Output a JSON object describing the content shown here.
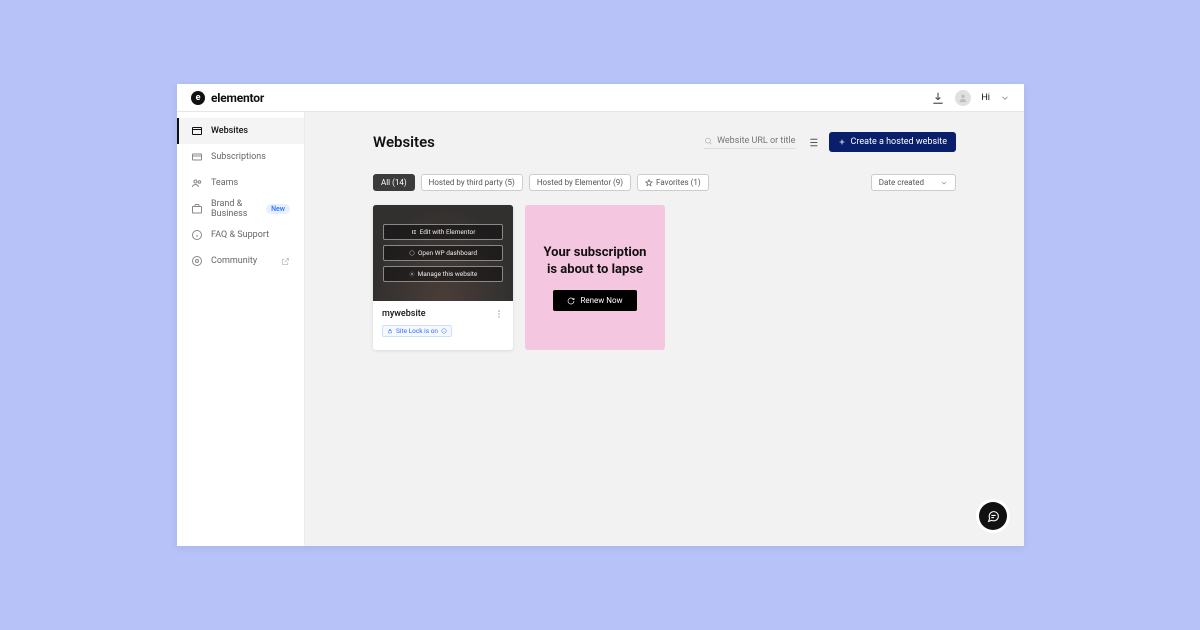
{
  "brand": "elementor",
  "greeting": "Hi",
  "sidebar": {
    "items": [
      {
        "label": "Websites"
      },
      {
        "label": "Subscriptions"
      },
      {
        "label": "Teams"
      },
      {
        "label": "Brand & Business"
      },
      {
        "label": "FAQ & Support"
      },
      {
        "label": "Community"
      }
    ],
    "new_badge": "New"
  },
  "page_title": "Websites",
  "search_placeholder": "Website URL or title",
  "create_label": "Create a hosted website",
  "filters": {
    "all": "All (14)",
    "third": "Hosted by third party (5)",
    "elementor": "Hosted by Elementor (9)",
    "fav": "Favorites (1)"
  },
  "sort_label": "Date created",
  "preview": {
    "edit": "Edit with Elementor",
    "wp": "Open WP dashboard",
    "manage": "Manage this website"
  },
  "card": {
    "title": "mywebsite",
    "lock": "Site Lock is on"
  },
  "promo": {
    "line1": "Your subscription",
    "line2": "is about to lapse",
    "renew": "Renew Now"
  }
}
